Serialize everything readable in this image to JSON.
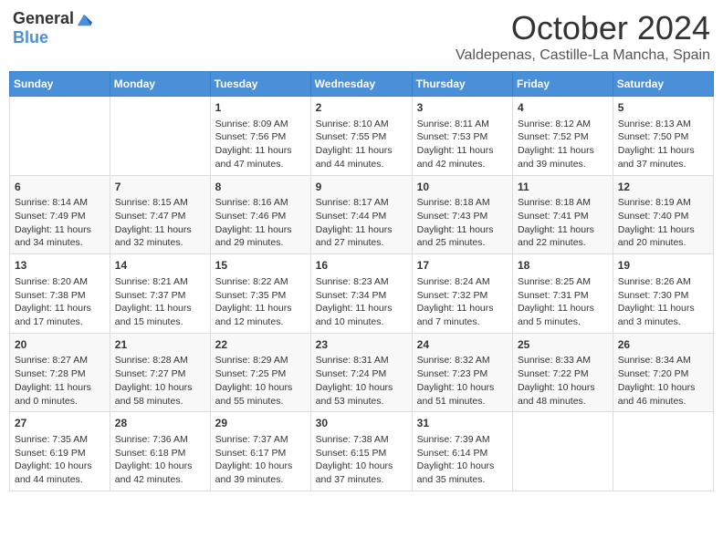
{
  "logo": {
    "general": "General",
    "blue": "Blue"
  },
  "title": "October 2024",
  "location": "Valdepenas, Castille-La Mancha, Spain",
  "days_of_week": [
    "Sunday",
    "Monday",
    "Tuesday",
    "Wednesday",
    "Thursday",
    "Friday",
    "Saturday"
  ],
  "weeks": [
    [
      {
        "day": "",
        "info": ""
      },
      {
        "day": "",
        "info": ""
      },
      {
        "day": "1",
        "info": "Sunrise: 8:09 AM\nSunset: 7:56 PM\nDaylight: 11 hours and 47 minutes."
      },
      {
        "day": "2",
        "info": "Sunrise: 8:10 AM\nSunset: 7:55 PM\nDaylight: 11 hours and 44 minutes."
      },
      {
        "day": "3",
        "info": "Sunrise: 8:11 AM\nSunset: 7:53 PM\nDaylight: 11 hours and 42 minutes."
      },
      {
        "day": "4",
        "info": "Sunrise: 8:12 AM\nSunset: 7:52 PM\nDaylight: 11 hours and 39 minutes."
      },
      {
        "day": "5",
        "info": "Sunrise: 8:13 AM\nSunset: 7:50 PM\nDaylight: 11 hours and 37 minutes."
      }
    ],
    [
      {
        "day": "6",
        "info": "Sunrise: 8:14 AM\nSunset: 7:49 PM\nDaylight: 11 hours and 34 minutes."
      },
      {
        "day": "7",
        "info": "Sunrise: 8:15 AM\nSunset: 7:47 PM\nDaylight: 11 hours and 32 minutes."
      },
      {
        "day": "8",
        "info": "Sunrise: 8:16 AM\nSunset: 7:46 PM\nDaylight: 11 hours and 29 minutes."
      },
      {
        "day": "9",
        "info": "Sunrise: 8:17 AM\nSunset: 7:44 PM\nDaylight: 11 hours and 27 minutes."
      },
      {
        "day": "10",
        "info": "Sunrise: 8:18 AM\nSunset: 7:43 PM\nDaylight: 11 hours and 25 minutes."
      },
      {
        "day": "11",
        "info": "Sunrise: 8:18 AM\nSunset: 7:41 PM\nDaylight: 11 hours and 22 minutes."
      },
      {
        "day": "12",
        "info": "Sunrise: 8:19 AM\nSunset: 7:40 PM\nDaylight: 11 hours and 20 minutes."
      }
    ],
    [
      {
        "day": "13",
        "info": "Sunrise: 8:20 AM\nSunset: 7:38 PM\nDaylight: 11 hours and 17 minutes."
      },
      {
        "day": "14",
        "info": "Sunrise: 8:21 AM\nSunset: 7:37 PM\nDaylight: 11 hours and 15 minutes."
      },
      {
        "day": "15",
        "info": "Sunrise: 8:22 AM\nSunset: 7:35 PM\nDaylight: 11 hours and 12 minutes."
      },
      {
        "day": "16",
        "info": "Sunrise: 8:23 AM\nSunset: 7:34 PM\nDaylight: 11 hours and 10 minutes."
      },
      {
        "day": "17",
        "info": "Sunrise: 8:24 AM\nSunset: 7:32 PM\nDaylight: 11 hours and 7 minutes."
      },
      {
        "day": "18",
        "info": "Sunrise: 8:25 AM\nSunset: 7:31 PM\nDaylight: 11 hours and 5 minutes."
      },
      {
        "day": "19",
        "info": "Sunrise: 8:26 AM\nSunset: 7:30 PM\nDaylight: 11 hours and 3 minutes."
      }
    ],
    [
      {
        "day": "20",
        "info": "Sunrise: 8:27 AM\nSunset: 7:28 PM\nDaylight: 11 hours and 0 minutes."
      },
      {
        "day": "21",
        "info": "Sunrise: 8:28 AM\nSunset: 7:27 PM\nDaylight: 10 hours and 58 minutes."
      },
      {
        "day": "22",
        "info": "Sunrise: 8:29 AM\nSunset: 7:25 PM\nDaylight: 10 hours and 55 minutes."
      },
      {
        "day": "23",
        "info": "Sunrise: 8:31 AM\nSunset: 7:24 PM\nDaylight: 10 hours and 53 minutes."
      },
      {
        "day": "24",
        "info": "Sunrise: 8:32 AM\nSunset: 7:23 PM\nDaylight: 10 hours and 51 minutes."
      },
      {
        "day": "25",
        "info": "Sunrise: 8:33 AM\nSunset: 7:22 PM\nDaylight: 10 hours and 48 minutes."
      },
      {
        "day": "26",
        "info": "Sunrise: 8:34 AM\nSunset: 7:20 PM\nDaylight: 10 hours and 46 minutes."
      }
    ],
    [
      {
        "day": "27",
        "info": "Sunrise: 7:35 AM\nSunset: 6:19 PM\nDaylight: 10 hours and 44 minutes."
      },
      {
        "day": "28",
        "info": "Sunrise: 7:36 AM\nSunset: 6:18 PM\nDaylight: 10 hours and 42 minutes."
      },
      {
        "day": "29",
        "info": "Sunrise: 7:37 AM\nSunset: 6:17 PM\nDaylight: 10 hours and 39 minutes."
      },
      {
        "day": "30",
        "info": "Sunrise: 7:38 AM\nSunset: 6:15 PM\nDaylight: 10 hours and 37 minutes."
      },
      {
        "day": "31",
        "info": "Sunrise: 7:39 AM\nSunset: 6:14 PM\nDaylight: 10 hours and 35 minutes."
      },
      {
        "day": "",
        "info": ""
      },
      {
        "day": "",
        "info": ""
      }
    ]
  ]
}
